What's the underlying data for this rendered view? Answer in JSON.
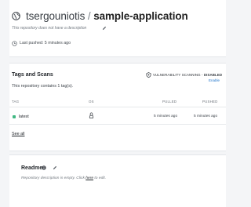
{
  "repo": {
    "namespace": "tsergouniotis",
    "separator": " / ",
    "name": "sample-application",
    "description_placeholder": "This repository does not have a description",
    "last_pushed": "Last pushed: 5 minutes ago"
  },
  "tags_section": {
    "title": "Tags and Scans",
    "contains_text": "This repository contains 1 tag(s).",
    "vuln_label": "VULNERABILITY SCANNING - ",
    "vuln_status": "DISABLED",
    "enable_link": "Enable",
    "columns": {
      "tag": "TAG",
      "os": "OS",
      "pulled": "PULLED",
      "pushed": "PUSHED"
    },
    "rows": [
      {
        "tag": "latest",
        "os_icon": "linux-icon",
        "pulled": "5 minutes ago",
        "pushed": "5 minutes ago"
      }
    ],
    "see_all": "See all"
  },
  "readme": {
    "title": "Readme",
    "desc_before": "Repository description is empty. Click ",
    "desc_link": "here",
    "desc_after": " to edit."
  },
  "colors": {
    "tag_dot": "#41b883",
    "link": "#1f75cb"
  }
}
